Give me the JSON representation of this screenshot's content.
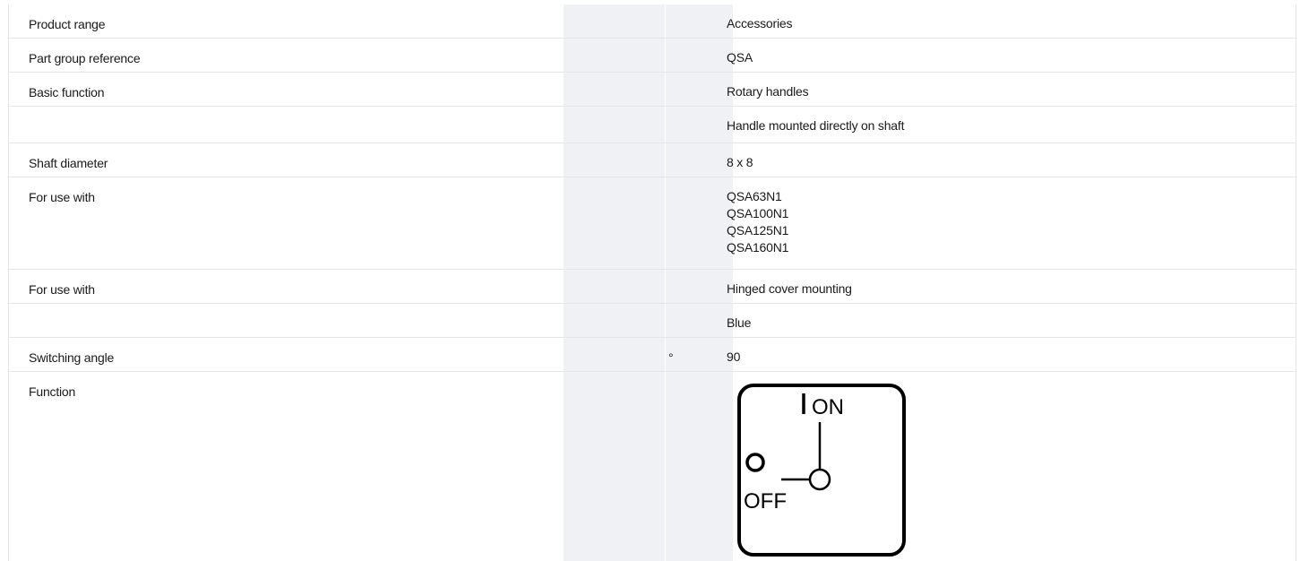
{
  "rows": [
    {
      "label": "Product range",
      "unit": "",
      "values": [
        "Accessories"
      ]
    },
    {
      "label": "Part group reference",
      "unit": "",
      "values": [
        "QSA"
      ]
    },
    {
      "label": "Basic function",
      "unit": "",
      "values": [
        "Rotary handles"
      ]
    },
    {
      "label": "",
      "unit": "",
      "values": [
        "Handle mounted directly on shaft"
      ]
    },
    {
      "label": "Shaft diameter",
      "unit": "",
      "values": [
        "8 x 8"
      ]
    },
    {
      "label": "For use with",
      "unit": "",
      "values": [
        "QSA63N1",
        "QSA100N1",
        "QSA125N1",
        "QSA160N1"
      ]
    },
    {
      "label": "For use with",
      "unit": "",
      "values": [
        "Hinged cover mounting"
      ]
    },
    {
      "label": "",
      "unit": "",
      "values": [
        "Blue"
      ]
    },
    {
      "label": "Switching angle",
      "unit": "°",
      "values": [
        "90"
      ]
    },
    {
      "label": "Function",
      "unit": "",
      "values": []
    }
  ],
  "function_diagram": {
    "on_label": "ON",
    "off_label": "OFF",
    "stroke_color": "#000000"
  }
}
